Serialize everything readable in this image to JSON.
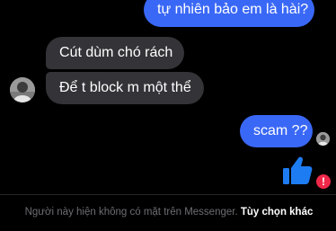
{
  "conversation": {
    "messages": [
      {
        "sender": "me",
        "text": "tự nhiên bảo em là hài?"
      },
      {
        "sender": "contact",
        "text": "Cút dùm chó rách"
      },
      {
        "sender": "contact",
        "text": "Để t block m một thể"
      },
      {
        "sender": "me",
        "text": "scam ??"
      },
      {
        "sender": "me",
        "type": "like-sticker",
        "status": "failed"
      }
    ],
    "error_badge": "!"
  },
  "footer": {
    "notice_text": "Người này hiện không có mặt trên Messenger. ",
    "link_text": "Tùy chọn khác"
  },
  "colors": {
    "outgoing_bubble": "#3a68f6",
    "incoming_bubble": "#333338",
    "like_icon": "#1e7cf2",
    "error": "#f02849"
  },
  "icons": {
    "like": "thumbs-up-icon",
    "error": "exclamation-icon",
    "contact_avatar": "avatar",
    "seen_indicator": "seen-avatar"
  }
}
